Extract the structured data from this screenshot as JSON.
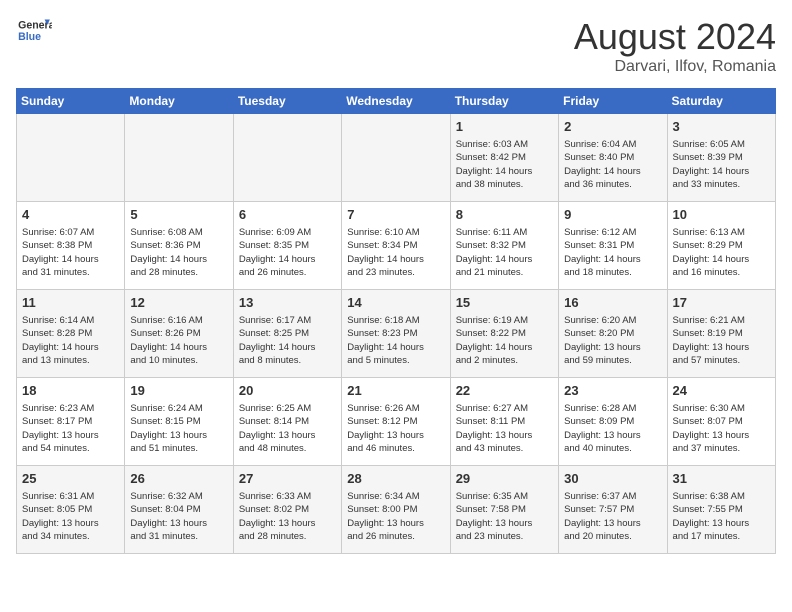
{
  "header": {
    "logo_line1": "General",
    "logo_line2": "Blue",
    "month": "August 2024",
    "location": "Darvari, Ilfov, Romania"
  },
  "weekdays": [
    "Sunday",
    "Monday",
    "Tuesday",
    "Wednesday",
    "Thursday",
    "Friday",
    "Saturday"
  ],
  "weeks": [
    [
      {
        "day": "",
        "content": ""
      },
      {
        "day": "",
        "content": ""
      },
      {
        "day": "",
        "content": ""
      },
      {
        "day": "",
        "content": ""
      },
      {
        "day": "1",
        "content": "Sunrise: 6:03 AM\nSunset: 8:42 PM\nDaylight: 14 hours\nand 38 minutes."
      },
      {
        "day": "2",
        "content": "Sunrise: 6:04 AM\nSunset: 8:40 PM\nDaylight: 14 hours\nand 36 minutes."
      },
      {
        "day": "3",
        "content": "Sunrise: 6:05 AM\nSunset: 8:39 PM\nDaylight: 14 hours\nand 33 minutes."
      }
    ],
    [
      {
        "day": "4",
        "content": "Sunrise: 6:07 AM\nSunset: 8:38 PM\nDaylight: 14 hours\nand 31 minutes."
      },
      {
        "day": "5",
        "content": "Sunrise: 6:08 AM\nSunset: 8:36 PM\nDaylight: 14 hours\nand 28 minutes."
      },
      {
        "day": "6",
        "content": "Sunrise: 6:09 AM\nSunset: 8:35 PM\nDaylight: 14 hours\nand 26 minutes."
      },
      {
        "day": "7",
        "content": "Sunrise: 6:10 AM\nSunset: 8:34 PM\nDaylight: 14 hours\nand 23 minutes."
      },
      {
        "day": "8",
        "content": "Sunrise: 6:11 AM\nSunset: 8:32 PM\nDaylight: 14 hours\nand 21 minutes."
      },
      {
        "day": "9",
        "content": "Sunrise: 6:12 AM\nSunset: 8:31 PM\nDaylight: 14 hours\nand 18 minutes."
      },
      {
        "day": "10",
        "content": "Sunrise: 6:13 AM\nSunset: 8:29 PM\nDaylight: 14 hours\nand 16 minutes."
      }
    ],
    [
      {
        "day": "11",
        "content": "Sunrise: 6:14 AM\nSunset: 8:28 PM\nDaylight: 14 hours\nand 13 minutes."
      },
      {
        "day": "12",
        "content": "Sunrise: 6:16 AM\nSunset: 8:26 PM\nDaylight: 14 hours\nand 10 minutes."
      },
      {
        "day": "13",
        "content": "Sunrise: 6:17 AM\nSunset: 8:25 PM\nDaylight: 14 hours\nand 8 minutes."
      },
      {
        "day": "14",
        "content": "Sunrise: 6:18 AM\nSunset: 8:23 PM\nDaylight: 14 hours\nand 5 minutes."
      },
      {
        "day": "15",
        "content": "Sunrise: 6:19 AM\nSunset: 8:22 PM\nDaylight: 14 hours\nand 2 minutes."
      },
      {
        "day": "16",
        "content": "Sunrise: 6:20 AM\nSunset: 8:20 PM\nDaylight: 13 hours\nand 59 minutes."
      },
      {
        "day": "17",
        "content": "Sunrise: 6:21 AM\nSunset: 8:19 PM\nDaylight: 13 hours\nand 57 minutes."
      }
    ],
    [
      {
        "day": "18",
        "content": "Sunrise: 6:23 AM\nSunset: 8:17 PM\nDaylight: 13 hours\nand 54 minutes."
      },
      {
        "day": "19",
        "content": "Sunrise: 6:24 AM\nSunset: 8:15 PM\nDaylight: 13 hours\nand 51 minutes."
      },
      {
        "day": "20",
        "content": "Sunrise: 6:25 AM\nSunset: 8:14 PM\nDaylight: 13 hours\nand 48 minutes."
      },
      {
        "day": "21",
        "content": "Sunrise: 6:26 AM\nSunset: 8:12 PM\nDaylight: 13 hours\nand 46 minutes."
      },
      {
        "day": "22",
        "content": "Sunrise: 6:27 AM\nSunset: 8:11 PM\nDaylight: 13 hours\nand 43 minutes."
      },
      {
        "day": "23",
        "content": "Sunrise: 6:28 AM\nSunset: 8:09 PM\nDaylight: 13 hours\nand 40 minutes."
      },
      {
        "day": "24",
        "content": "Sunrise: 6:30 AM\nSunset: 8:07 PM\nDaylight: 13 hours\nand 37 minutes."
      }
    ],
    [
      {
        "day": "25",
        "content": "Sunrise: 6:31 AM\nSunset: 8:05 PM\nDaylight: 13 hours\nand 34 minutes."
      },
      {
        "day": "26",
        "content": "Sunrise: 6:32 AM\nSunset: 8:04 PM\nDaylight: 13 hours\nand 31 minutes."
      },
      {
        "day": "27",
        "content": "Sunrise: 6:33 AM\nSunset: 8:02 PM\nDaylight: 13 hours\nand 28 minutes."
      },
      {
        "day": "28",
        "content": "Sunrise: 6:34 AM\nSunset: 8:00 PM\nDaylight: 13 hours\nand 26 minutes."
      },
      {
        "day": "29",
        "content": "Sunrise: 6:35 AM\nSunset: 7:58 PM\nDaylight: 13 hours\nand 23 minutes."
      },
      {
        "day": "30",
        "content": "Sunrise: 6:37 AM\nSunset: 7:57 PM\nDaylight: 13 hours\nand 20 minutes."
      },
      {
        "day": "31",
        "content": "Sunrise: 6:38 AM\nSunset: 7:55 PM\nDaylight: 13 hours\nand 17 minutes."
      }
    ]
  ]
}
